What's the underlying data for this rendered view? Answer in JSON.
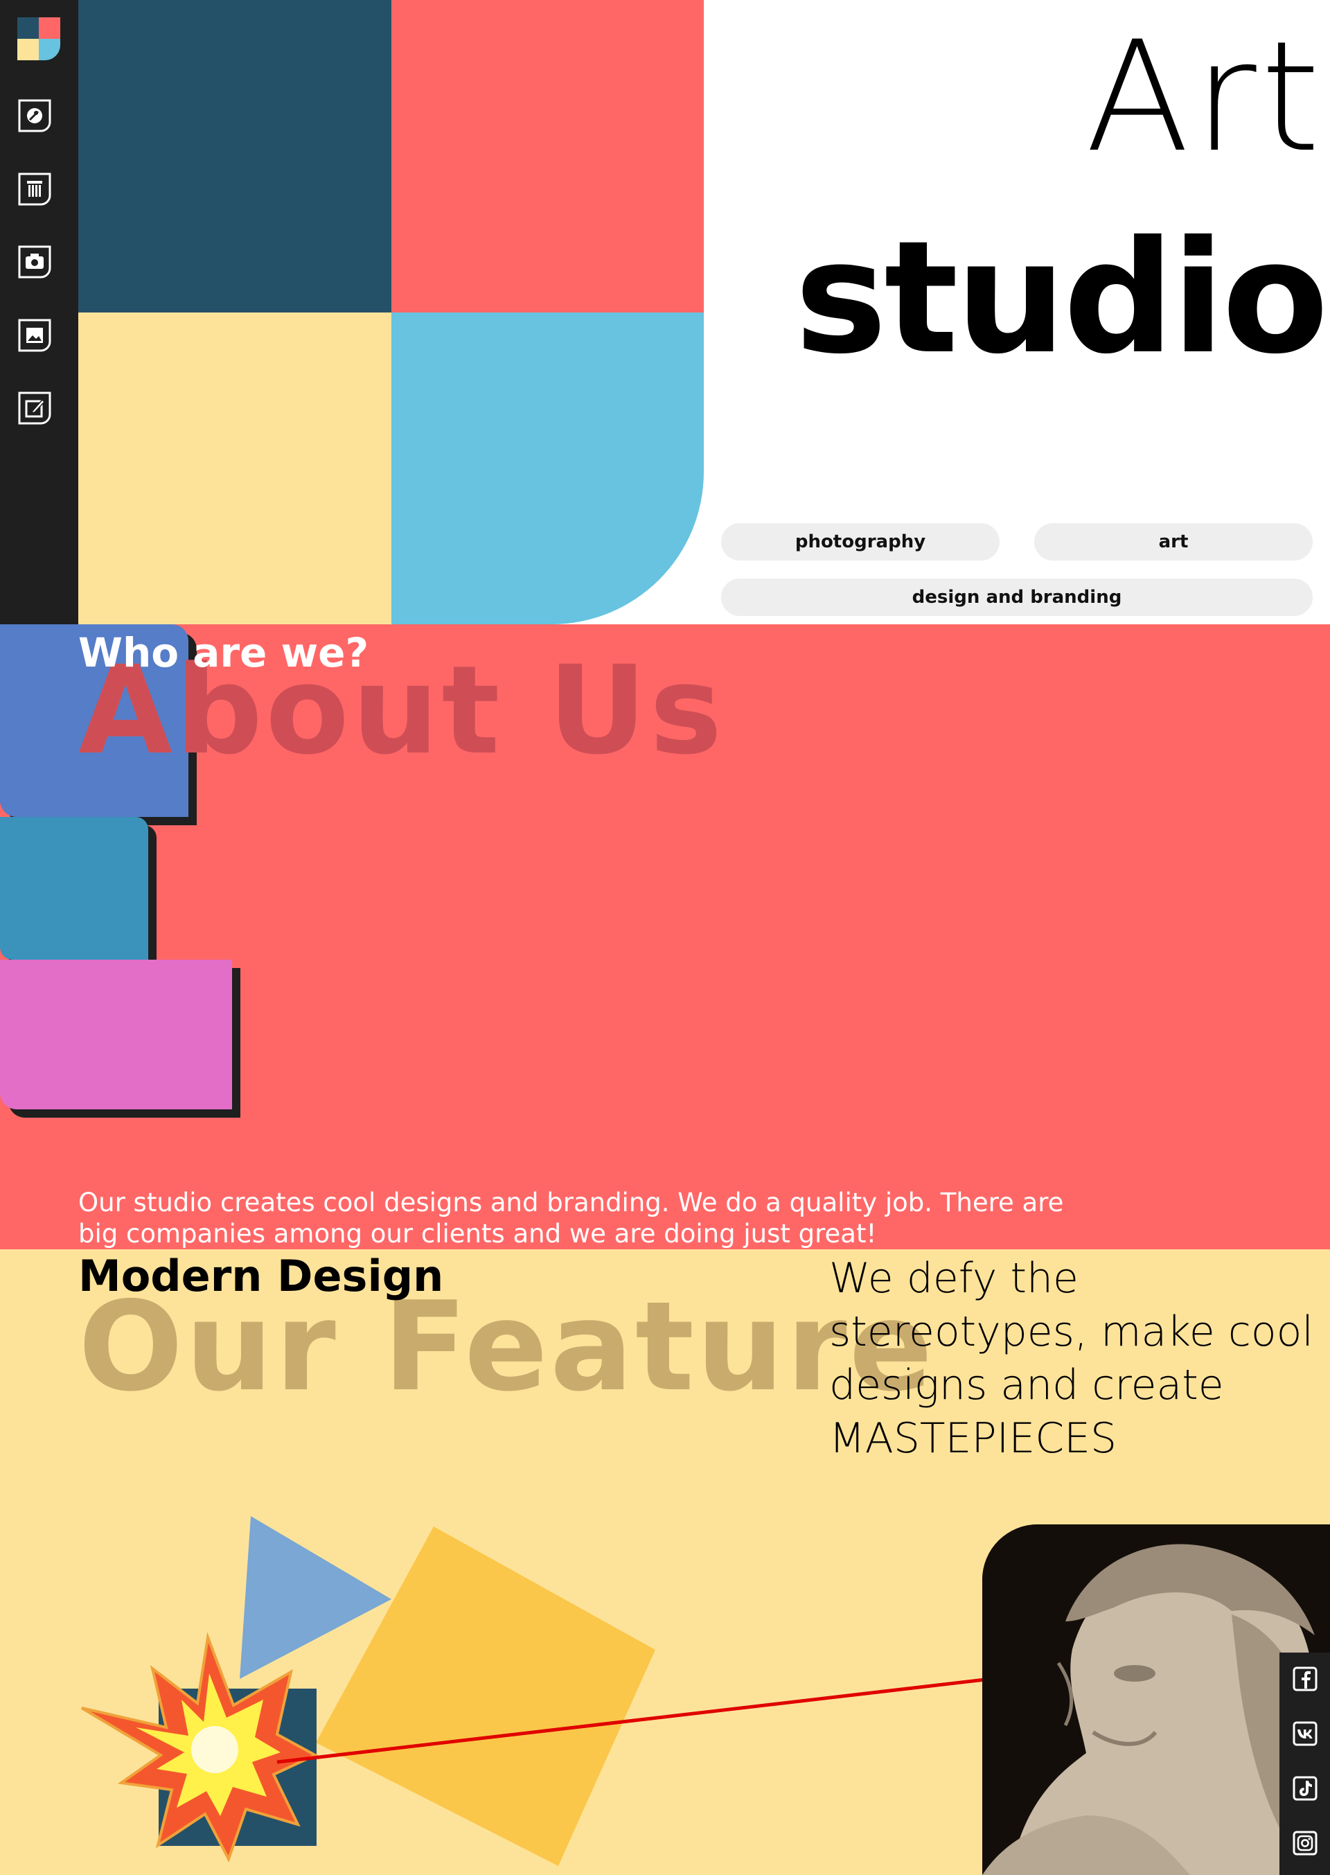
{
  "hero": {
    "title_line1": "Art",
    "title_line2": "studio",
    "tags": {
      "photography": "photography",
      "art": "art",
      "design": "design and branding"
    },
    "colors": {
      "navy": "#255168",
      "coral": "#ff6767",
      "cream": "#fde39a",
      "sky": "#67c3e0"
    }
  },
  "sidebar": {
    "icons": [
      "logo-icon",
      "palette-icon",
      "column-icon",
      "camera-icon",
      "image-icon",
      "edit-icon"
    ]
  },
  "about": {
    "kicker": "Who are we?",
    "ghost": "About Us",
    "text": "Our studio creates cool designs and branding. We do a quality job. There are big companies among our clients and we are doing just great!"
  },
  "feature": {
    "kicker": "Modern Design",
    "ghost": "Our Feature",
    "lead": "We defy the stereotypes, make cool designs and create MASTEPIECES"
  },
  "social": {
    "icons": [
      "facebook-icon",
      "vk-icon",
      "tiktok-icon",
      "instagram-icon"
    ]
  }
}
